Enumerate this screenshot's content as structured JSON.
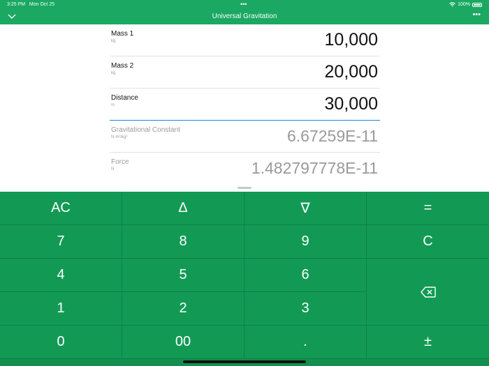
{
  "status_bar": {
    "time": "3:25 PM",
    "date": "Mon Oct 25",
    "battery": "100%"
  },
  "nav": {
    "title": "Universal Gravitation"
  },
  "fields": [
    {
      "label": "Mass 1",
      "unit": "kg",
      "value": "10,000"
    },
    {
      "label": "Mass 2",
      "unit": "kg",
      "value": "20,000"
    },
    {
      "label": "Distance",
      "unit": "m",
      "value": "30,000"
    },
    {
      "label": "Gravitational Constant",
      "unit": "N·m²/kg²",
      "value": "6.67259E-11"
    },
    {
      "label": "Force",
      "unit": "N",
      "value": "1.482797778E-11"
    }
  ],
  "keypad": {
    "ac": "AC",
    "up": "∆",
    "down": "∇",
    "equals": "=",
    "k7": "7",
    "k8": "8",
    "k9": "9",
    "clear": "C",
    "k4": "4",
    "k5": "5",
    "k6": "6",
    "k1": "1",
    "k2": "2",
    "k3": "3",
    "k0": "0",
    "k00": "00",
    "dot": ".",
    "plusminus": "±"
  },
  "colors": {
    "accent": "#1aa862",
    "keypad": "#129a55",
    "active_underline": "#1a7fd6"
  }
}
